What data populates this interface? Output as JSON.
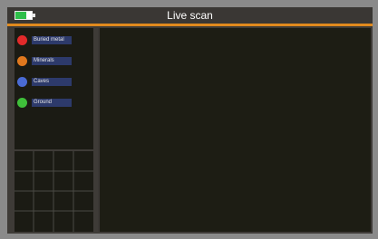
{
  "header": {
    "title": "Live scan"
  },
  "colors": {
    "accent": "#e08a1e",
    "battery": "#2fbf4a"
  },
  "legend": {
    "items": [
      {
        "label": "Buried metal",
        "color": "#e22a2a"
      },
      {
        "label": "Minerals",
        "color": "#e0781e"
      },
      {
        "label": "Caves",
        "color": "#4a6bd4"
      },
      {
        "label": "Ground",
        "color": "#3fbf3a"
      }
    ]
  }
}
